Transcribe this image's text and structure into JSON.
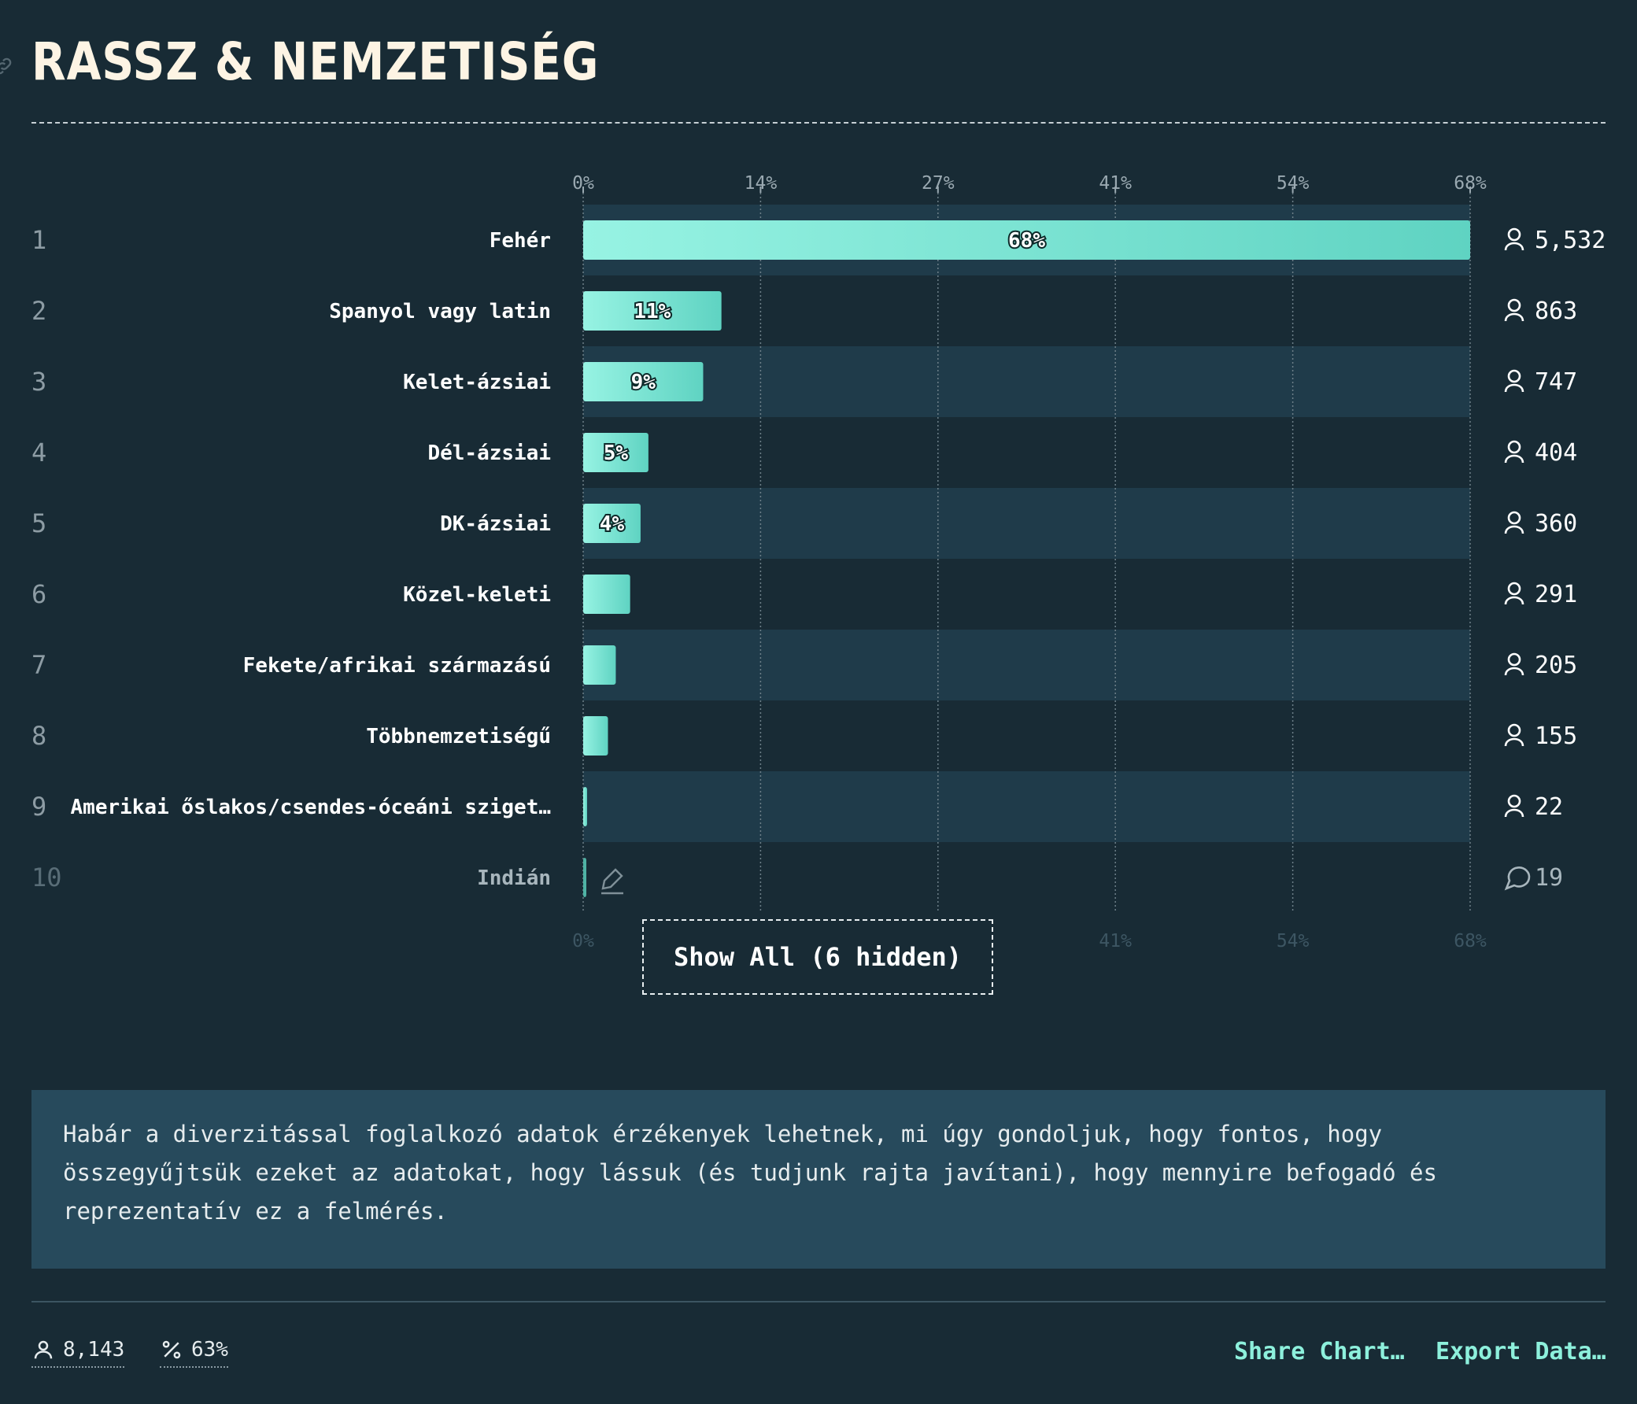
{
  "title": "RASSZ & NEMZETISÉG",
  "show_all_label": "Show All (6 hidden)",
  "note": "Habár a diverzitással foglalkozó adatok érzékenyek lehetnek, mi úgy gondoljuk, hogy fontos, hogy összegyűjtsük ezeket az adatokat, hogy lássuk (és tudjunk rajta javítani), hogy mennyire befogadó és reprezentatív ez a felmérés.",
  "footer": {
    "respondents": "8,143",
    "percent": "63%",
    "share_label": "Share Chart…",
    "export_label": "Export Data…"
  },
  "colors": {
    "background": "#182b35",
    "bar_start": "#97f3e3",
    "bar_end": "#5fd3c2",
    "row_alt": "#1f3b4a",
    "note_bg": "#274a5c",
    "accent": "#8df0dc"
  },
  "chart_data": {
    "type": "bar",
    "orientation": "horizontal",
    "x_ticks": [
      "0%",
      "14%",
      "27%",
      "41%",
      "54%",
      "68%"
    ],
    "xlim": [
      0,
      68
    ],
    "grid": true,
    "rows": [
      {
        "rank": "1",
        "label": "Fehér",
        "value": 68,
        "value_label": "68%",
        "count": "5,532",
        "icon": "person-icon"
      },
      {
        "rank": "2",
        "label": "Spanyol vagy latin",
        "value": 10.6,
        "value_label": "11%",
        "count": "863",
        "icon": "person-icon"
      },
      {
        "rank": "3",
        "label": "Kelet-ázsiai",
        "value": 9.2,
        "value_label": "9%",
        "count": "747",
        "icon": "person-icon"
      },
      {
        "rank": "4",
        "label": "Dél-ázsiai",
        "value": 5.0,
        "value_label": "5%",
        "count": "404",
        "icon": "person-icon"
      },
      {
        "rank": "5",
        "label": "DK-ázsiai",
        "value": 4.4,
        "value_label": "4%",
        "count": "360",
        "icon": "person-icon"
      },
      {
        "rank": "6",
        "label": "Közel-keleti",
        "value": 3.6,
        "value_label": "",
        "count": "291",
        "icon": "person-icon"
      },
      {
        "rank": "7",
        "label": "Fekete/afrikai származású",
        "value": 2.5,
        "value_label": "",
        "count": "205",
        "icon": "person-icon"
      },
      {
        "rank": "8",
        "label": "Többnemzetiségű",
        "value": 1.9,
        "value_label": "",
        "count": "155",
        "icon": "person-icon"
      },
      {
        "rank": "9",
        "label": "Amerikai őslakos/csendes-óceáni sziget…",
        "value": 0.3,
        "value_label": "",
        "count": "22",
        "icon": "person-icon"
      },
      {
        "rank": "10",
        "label": "Indián",
        "value": 0.2,
        "value_label": "",
        "count": "19",
        "icon": "comment-icon"
      }
    ]
  }
}
